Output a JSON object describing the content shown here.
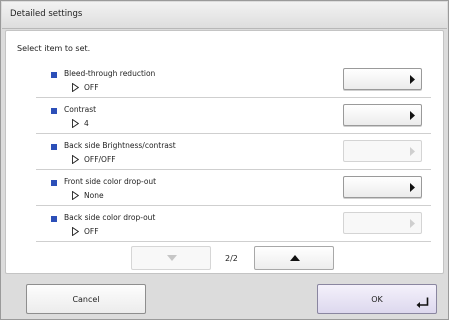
{
  "dialog": {
    "title": "Detailed settings"
  },
  "instruction": "Select item to set.",
  "colors": {
    "accent": "#2c4fb8",
    "ok_background": "#e6e2f2"
  },
  "settings": [
    {
      "label": "Bleed-through reduction",
      "value": "OFF",
      "enabled": true
    },
    {
      "label": "Contrast",
      "value": "4",
      "enabled": true
    },
    {
      "label": "Back side Brightness/contrast",
      "value": "OFF/OFF",
      "enabled": false
    },
    {
      "label": "Front side color drop-out",
      "value": "None",
      "enabled": true
    },
    {
      "label": "Back side color drop-out",
      "value": "OFF",
      "enabled": false
    }
  ],
  "pagination": {
    "current": 2,
    "total": 2,
    "label": "2/2",
    "prev_enabled": false,
    "next_enabled": true
  },
  "footer": {
    "cancel_label": "Cancel",
    "ok_label": "OK"
  },
  "icons": {
    "row_marker": "square-bullet-icon",
    "value_marker": "outline-triangle-right-icon",
    "button_arrow": "triangle-right-icon",
    "ok_enter": "enter-return-icon"
  }
}
